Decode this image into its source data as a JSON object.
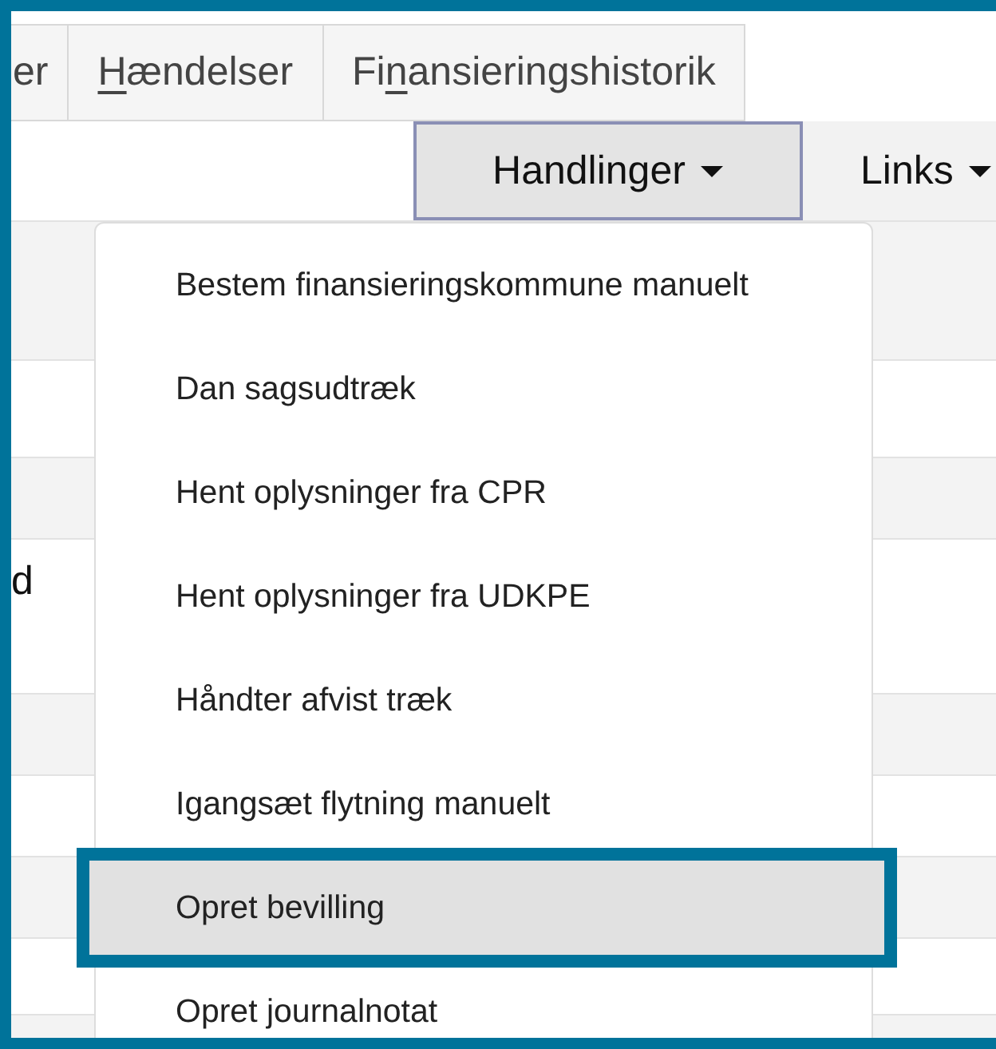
{
  "tabs": [
    {
      "label": "er"
    },
    {
      "key": "H",
      "after": "ændelser"
    },
    {
      "before": "Fi",
      "key": "n",
      "after": "ansieringshistorik"
    }
  ],
  "toolbar": {
    "buttons": [
      {
        "label": "Handlinger",
        "expanded": true
      },
      {
        "label": "Links",
        "expanded": false
      }
    ]
  },
  "table": {
    "cell": "d"
  },
  "menu": {
    "items": [
      {
        "label": "Bestem finansieringskommune manuelt",
        "selected": false
      },
      {
        "label": "Dan sagsudtræk",
        "selected": false
      },
      {
        "label": "Hent oplysninger fra CPR",
        "selected": false
      },
      {
        "label": "Hent oplysninger fra UDKPE",
        "selected": false
      },
      {
        "label": "Håndter afvist træk",
        "selected": false
      },
      {
        "label": "Igangsæt flytning manuelt",
        "selected": false
      },
      {
        "label": "Opret bevilling",
        "selected": true
      },
      {
        "label": "Opret journalnotat",
        "selected": false
      }
    ]
  }
}
